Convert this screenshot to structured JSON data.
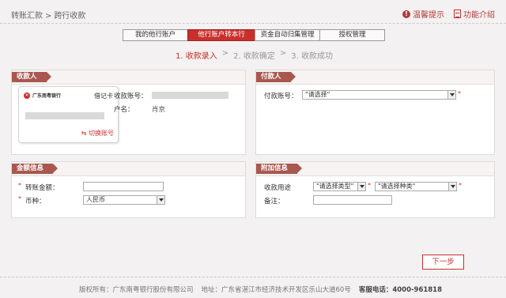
{
  "breadcrumb": {
    "parent": "转账汇款",
    "separator": ">",
    "current": "跨行收款"
  },
  "top_links": {
    "tips": "温馨提示",
    "intro": "功能介绍"
  },
  "tabs": [
    {
      "label": "我的他行账户"
    },
    {
      "label": "他行账户转本行"
    },
    {
      "label": "资金自动归集管理"
    },
    {
      "label": "授权管理"
    }
  ],
  "steps": {
    "step1": "1. 收款录入",
    "sep1": ">",
    "step2": "2. 收款确定",
    "sep2": ">",
    "step3": "3. 收款成功"
  },
  "payee": {
    "title": "收款人",
    "card_bank": "广东南粤银行",
    "card_type": "借记卡",
    "switch_label": "切换账号",
    "account_label": "收款账号：",
    "name_label": "户名：",
    "name_value": "肖京"
  },
  "payer": {
    "title": "付款人",
    "account_label": "付款账号：",
    "account_select": "\"请选择\"",
    "required_mark": "*"
  },
  "amount": {
    "title": "金额信息",
    "amount_label": "转账金额：",
    "currency_label": "币种：",
    "currency_value": "人民币",
    "required_mark": "*"
  },
  "extra": {
    "title": "附加信息",
    "purpose_label": "收款用途",
    "type_select": "\"请选择类型\"",
    "kind_select": "\"请选择种类\"",
    "remark_label": "备注：",
    "required_mark": "*"
  },
  "next_button": "下一步",
  "footer": {
    "copyright": "版权所有：广东南粤银行股份有限公司",
    "address": "地址：广东省湛江市经济技术开发区乐山大道60号",
    "hotline": "客服电话：4000-961818"
  },
  "colors": {
    "accent": "#c9302c",
    "panel_title": "#a8584f"
  }
}
